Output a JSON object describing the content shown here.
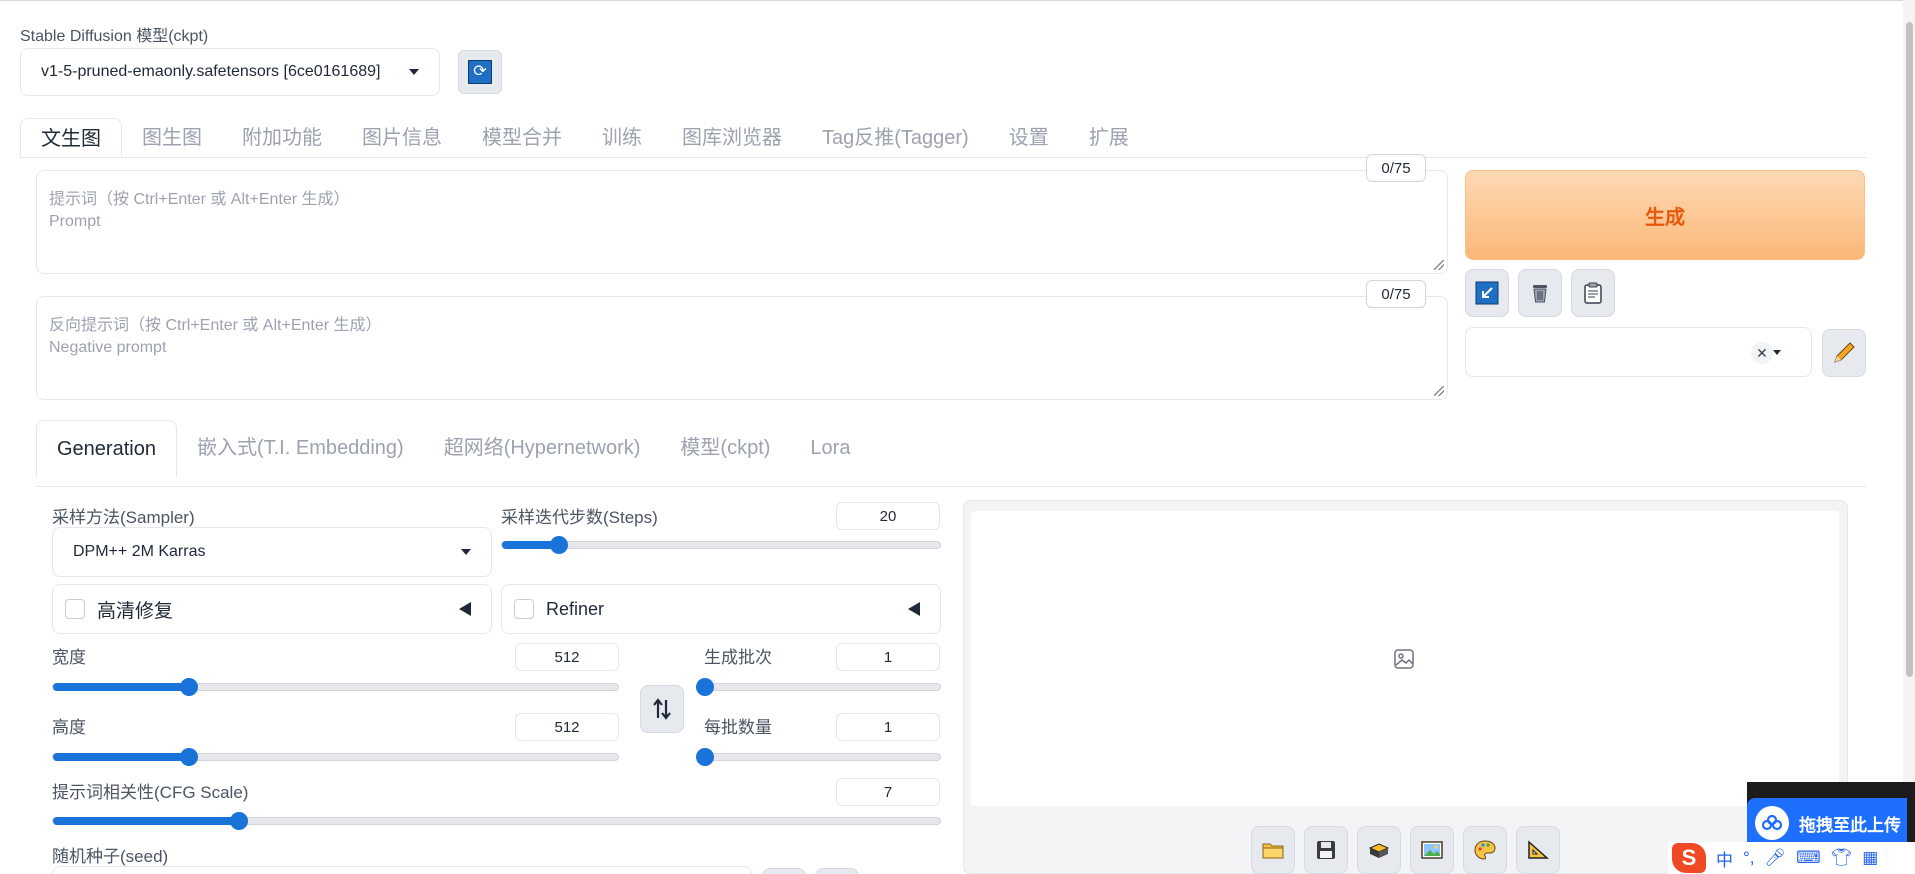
{
  "model": {
    "label": "Stable Diffusion 模型(ckpt)",
    "value": "v1-5-pruned-emaonly.safetensors [6ce0161689]"
  },
  "main_tabs": [
    {
      "label": "文生图",
      "active": true
    },
    {
      "label": "图生图"
    },
    {
      "label": "附加功能"
    },
    {
      "label": "图片信息"
    },
    {
      "label": "模型合并"
    },
    {
      "label": "训练"
    },
    {
      "label": "图库浏览器"
    },
    {
      "label": "Tag反推(Tagger)"
    },
    {
      "label": "设置"
    },
    {
      "label": "扩展"
    }
  ],
  "prompt": {
    "counter": "0/75",
    "placeholder_line1": "提示词（按 Ctrl+Enter 或 Alt+Enter 生成）",
    "placeholder_line2": "Prompt"
  },
  "negative_prompt": {
    "counter": "0/75",
    "placeholder_line1": "反向提示词（按 Ctrl+Enter 或 Alt+Enter 生成）",
    "placeholder_line2": "Negative prompt"
  },
  "generate_label": "生成",
  "sub_tabs": [
    {
      "label": "Generation",
      "active": true
    },
    {
      "label": "嵌入式(T.I. Embedding)"
    },
    {
      "label": "超网络(Hypernetwork)"
    },
    {
      "label": "模型(ckpt)"
    },
    {
      "label": "Lora"
    }
  ],
  "sampler": {
    "label": "采样方法(Sampler)",
    "value": "DPM++ 2M Karras"
  },
  "steps": {
    "label": "采样迭代步数(Steps)",
    "value": "20",
    "fraction": 0.13
  },
  "hires_fix": {
    "label": "高清修复"
  },
  "refiner": {
    "label": "Refiner"
  },
  "width": {
    "label": "宽度",
    "value": "512",
    "fraction": 0.24
  },
  "height": {
    "label": "高度",
    "value": "512",
    "fraction": 0.24
  },
  "batch_count": {
    "label": "生成批次",
    "value": "1",
    "fraction": 0.0
  },
  "batch_size": {
    "label": "每批数量",
    "value": "1",
    "fraction": 0.0
  },
  "cfg_scale": {
    "label": "提示词相关性(CFG Scale)",
    "value": "7",
    "fraction": 0.21
  },
  "seed": {
    "label": "随机种子(seed)"
  },
  "upload_widget": {
    "label": "拖拽至此上传"
  },
  "ime": {
    "lang": "中",
    "punct": "°,"
  },
  "colors": {
    "accent": "#1a73d9",
    "generate_text": "#ea580c",
    "upload_blue": "#1e6fff"
  }
}
